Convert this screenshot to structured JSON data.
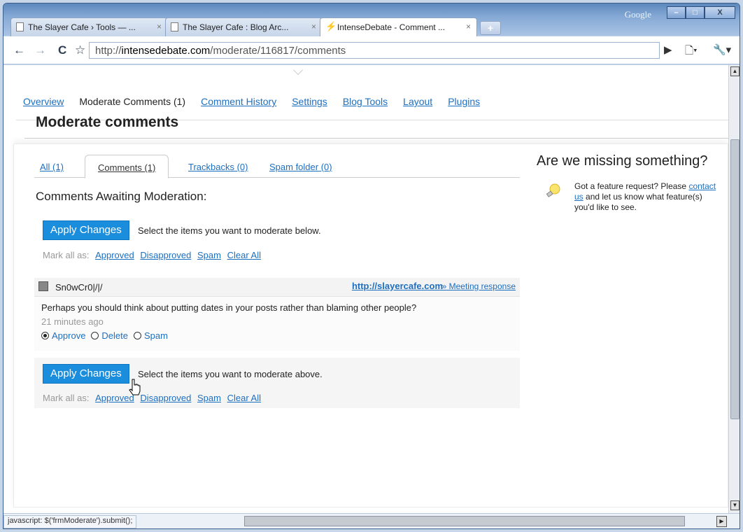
{
  "browser": {
    "tabs": [
      {
        "label": "The Slayer Cafe › Tools — ...",
        "close": "×"
      },
      {
        "label": "The Slayer Cafe : Blog Arc...",
        "close": "×"
      },
      {
        "label": "IntenseDebate - Comment ...",
        "close": "×"
      }
    ],
    "new_tab": "+",
    "google_label": "Google",
    "window_buttons": {
      "minimize": "–",
      "maximize": "□",
      "close": "X"
    },
    "nav": {
      "back": "←",
      "forward": "→",
      "reload": "C",
      "star": "☆"
    },
    "url": {
      "prefix": "http://",
      "domain": "intensedebate.com",
      "path": "/moderate/116817/comments"
    },
    "toolbar_right": {
      "play": "▶",
      "page": "🗋▾",
      "tools": "🔧▾"
    },
    "status_text": "javascript: $('frmModerate').submit();"
  },
  "page_nav": {
    "overview": "Overview",
    "moderate": "Moderate Comments (1)",
    "history": "Comment History",
    "settings": "Settings",
    "blog_tools": "Blog Tools",
    "layout": "Layout",
    "plugins": "Plugins"
  },
  "main": {
    "title": "Moderate comments",
    "tabs": {
      "all": "All (1)",
      "comments": "Comments (1)",
      "trackbacks": "Trackbacks (0)",
      "spam": "Spam folder (0)"
    },
    "awaiting": "Comments Awaiting Moderation:",
    "apply_label": "Apply Changes",
    "hint_top": "Select the items you want to moderate below.",
    "hint_bottom": "Select the items you want to moderate above.",
    "mark_all": {
      "label": "Mark all as:",
      "approved": "Approved",
      "disapproved": "Disapproved",
      "spam": "Spam",
      "clear": "Clear All"
    },
    "comment": {
      "author": "Sn0wCr0|/|/",
      "site": "http://slayercafe.com",
      "post": "» Meeting response",
      "text": "Perhaps you should think about putting dates in your posts rather than blaming other people?",
      "time": "21 minutes ago",
      "options": {
        "approve": "Approve",
        "delete": "Delete",
        "spam": "Spam"
      },
      "selected": "approve"
    }
  },
  "sidebar": {
    "title": "Are we missing something?",
    "text_before": "Got a feature request? Please ",
    "link": "contact us",
    "text_after": " and let us know what feature(s) you'd like to see."
  }
}
